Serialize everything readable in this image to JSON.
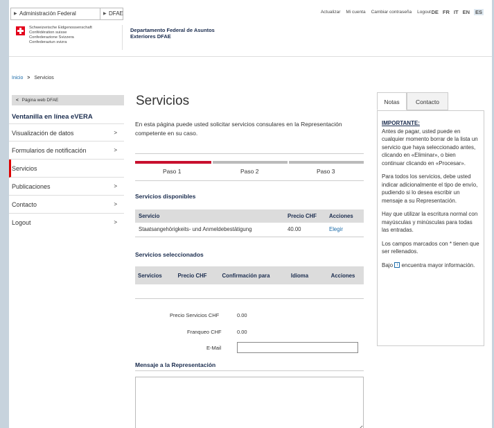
{
  "topnav": {
    "crumb1": "Administración Federal",
    "crumb2": "DFAE",
    "links": [
      "Actualizar",
      "Mi cuenta",
      "Cambiar contraseña",
      "Logout"
    ],
    "languages": [
      "DE",
      "FR",
      "IT",
      "EN",
      "ES"
    ],
    "active_language": "ES"
  },
  "header": {
    "confed_lines": [
      "Schweizerische Eidgenossenschaft",
      "Confédération suisse",
      "Confederazione Svizzera",
      "Confederaziun svizra"
    ],
    "dept_line1": "Departamento Federal de Asuntos",
    "dept_line2": "Exteriores DFAE"
  },
  "breadcrumb": {
    "home": "Inicio",
    "sep": ">",
    "current": "Servicios"
  },
  "sidebar": {
    "back_label": "Página web DFAE",
    "title": "Ventanilla en línea eVERA",
    "items": [
      {
        "label": "Visualización de datos",
        "arrow": ">"
      },
      {
        "label": "Formularios de notificación",
        "arrow": ">"
      },
      {
        "label": "Servicios",
        "arrow": ""
      },
      {
        "label": "Publicaciones",
        "arrow": ">"
      },
      {
        "label": "Contacto",
        "arrow": ">"
      },
      {
        "label": "Logout",
        "arrow": ">"
      }
    ]
  },
  "main": {
    "title": "Servicios",
    "intro": "En esta página puede usted solicitar servicios consulares en la Representación competente en su caso.",
    "steps": [
      "Paso 1",
      "Paso 2",
      "Paso 3"
    ],
    "available_heading": "Servicios disponibles",
    "available_table": {
      "headers": [
        "Servicio",
        "Precio CHF",
        "Acciones"
      ],
      "rows": [
        [
          "Staatsangehörigkeits- und Anmeldebestätigung",
          "40.00",
          "Elegir"
        ]
      ]
    },
    "selected_heading": "Servicios seleccionados",
    "selected_table": {
      "headers": [
        "Servicios",
        "Precio CHF",
        "Confirmación para",
        "Idioma",
        "Acciones"
      ]
    },
    "price_label": "Precio Servicios CHF",
    "price_value": "0.00",
    "postage_label": "Franqueo CHF",
    "postage_value": "0.00",
    "email_label": "E-Mail",
    "email_value": "",
    "message_heading": "Mensaje a la Representación"
  },
  "rightpanel": {
    "tabs": [
      "Notas",
      "Contacto"
    ],
    "important": "IMPORTANTE:",
    "p1": "Antes de pagar, usted puede en cualquier momento borrar de la lista un servicio que haya seleccionado antes, clicando en «Eliminar», o bien continuar clicando en «Procesar».",
    "p2": "Para todos los servicios, debe usted indicar adicionalmente el tipo de envío, pudiendo si lo desea escribir un mensaje a su Representación.",
    "p3": "Hay que utilizar la escritura normal con mayúsculas y minúsculas para todas las entradas.",
    "p4": "Los campos marcados con * tienen que ser rellenados.",
    "p5a": "Bajo",
    "p5b": "encuentra mayor información."
  }
}
